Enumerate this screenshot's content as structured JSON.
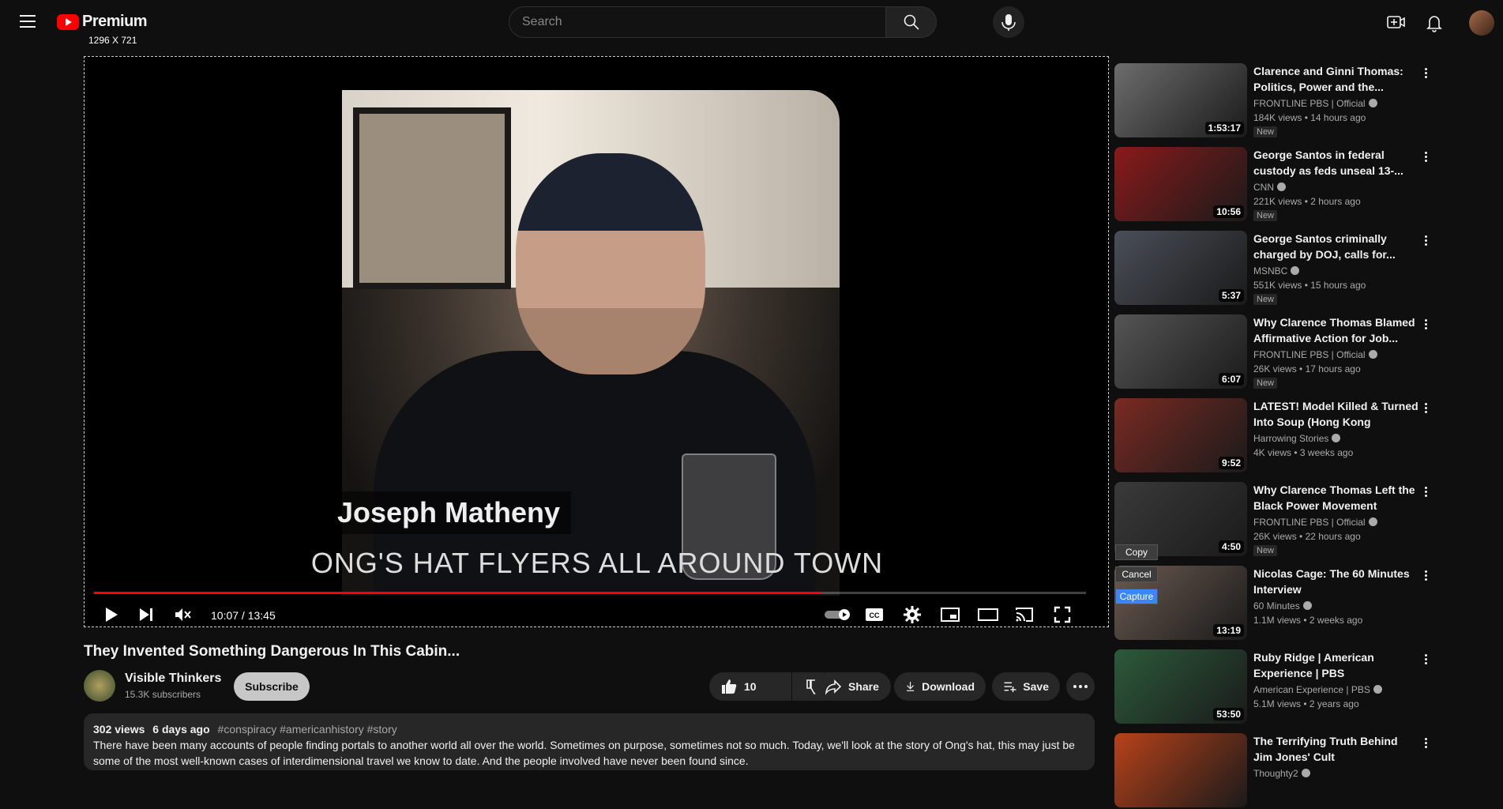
{
  "app": {
    "logo_text": "Premium",
    "dimension_label": "1296 X 721"
  },
  "search": {
    "placeholder": "Search"
  },
  "player": {
    "name_tag": "Joseph Matheny",
    "subtitle": "ONG'S HAT FLYERS ALL AROUND TOWN",
    "time": "10:07 / 13:45",
    "progress": 0.733
  },
  "video": {
    "title": "They Invented Something Dangerous In This Cabin...",
    "channel": "Visible Thinkers",
    "subscribers": "15.3K subscribers",
    "subscribe_label": "Subscribe",
    "likes": "10",
    "share_label": "Share",
    "download_label": "Download",
    "save_label": "Save",
    "views": "302 views",
    "age": "6 days ago",
    "tags": "#conspiracy #americanhistory #story",
    "description": "There have been many accounts of people finding portals to another world all over the world. Sometimes on purpose, sometimes not so much. Today, we'll look at the story of Ong's hat, this may just be some of the most well-known cases of interdimensional travel we know to date. And the people involved have never been found since."
  },
  "recommendations": [
    {
      "title": "Clarence and Ginni Thomas: Politics, Power and the...",
      "channel": "FRONTLINE PBS | Official",
      "views": "184K views",
      "age": "14 hours ago",
      "badge": "New",
      "duration": "1:53:17",
      "thumb_color": "#6d6d6d"
    },
    {
      "title": "George Santos in federal custody as feds unseal 13-...",
      "channel": "CNN",
      "views": "221K views",
      "age": "2 hours ago",
      "badge": "New",
      "duration": "10:56",
      "thumb_color": "#8a1a1a"
    },
    {
      "title": "George Santos criminally charged by DOJ, calls for...",
      "channel": "MSNBC",
      "views": "551K views",
      "age": "15 hours ago",
      "badge": "New",
      "duration": "5:37",
      "thumb_color": "#4a4f58"
    },
    {
      "title": "Why Clarence Thomas Blamed Affirmative Action for Job...",
      "channel": "FRONTLINE PBS | Official",
      "views": "26K views",
      "age": "17 hours ago",
      "badge": "New",
      "duration": "6:07",
      "thumb_color": "#555555"
    },
    {
      "title": "LATEST! Model Killed & Turned Into Soup (Hong Kong Murder)...",
      "channel": "Harrowing Stories",
      "views": "4K views",
      "age": "3 weeks ago",
      "badge": "",
      "duration": "9:52",
      "thumb_color": "#7a2a22"
    },
    {
      "title": "Why Clarence Thomas Left the Black Power Movement Behin...",
      "channel": "FRONTLINE PBS | Official",
      "views": "26K views",
      "age": "22 hours ago",
      "badge": "New",
      "duration": "4:50",
      "thumb_color": "#3a3a3a"
    },
    {
      "title": "Nicolas Cage: The 60 Minutes Interview",
      "channel": "60 Minutes",
      "views": "1.1M views",
      "age": "2 weeks ago",
      "badge": "",
      "duration": "13:19",
      "thumb_color": "#6b5a50"
    },
    {
      "title": "Ruby Ridge | American Experience | PBS",
      "channel": "American Experience | PBS",
      "views": "5.1M views",
      "age": "2 years ago",
      "badge": "",
      "duration": "53:50",
      "thumb_color": "#2c5a3a"
    },
    {
      "title": "The Terrifying Truth Behind Jim Jones' Cult",
      "channel": "Thoughty2",
      "views": "",
      "age": "",
      "badge": "",
      "duration": "",
      "thumb_color": "#b8421a"
    }
  ],
  "capture_menu": {
    "copy": "Copy",
    "cancel": "Cancel",
    "capture": "Capture"
  },
  "colors": {
    "accent": "#ff0000",
    "capture_blue": "#3a86ff",
    "background": "#0f0f0f"
  }
}
